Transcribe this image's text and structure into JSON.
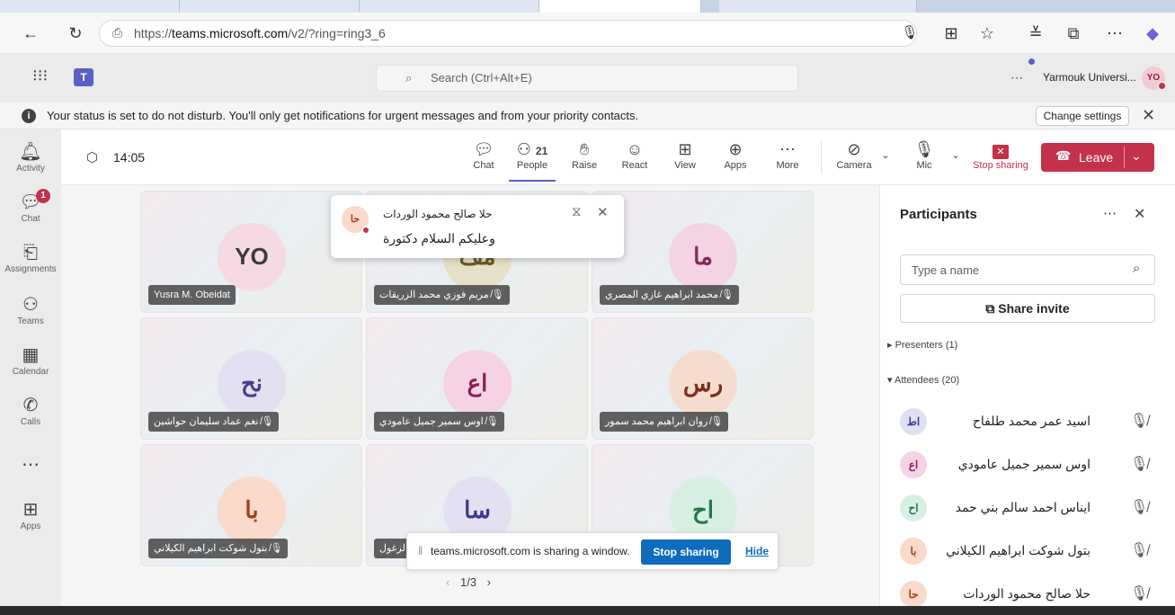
{
  "browser": {
    "url_prefix": "https://",
    "url_host": "teams.microsoft.com",
    "url_path": "/v2/?ring=ring3_6"
  },
  "header": {
    "search_placeholder": "Search (Ctrl+Alt+E)",
    "org_name": "Yarmouk Universi...",
    "user_initials": "YO"
  },
  "notification": {
    "text": "Your status is set to do not disturb. You'll only get notifications for urgent messages and from your priority contacts.",
    "button": "Change settings"
  },
  "rail": [
    {
      "label": "Activity"
    },
    {
      "label": "Chat",
      "badge": "1"
    },
    {
      "label": "Assignments"
    },
    {
      "label": "Teams"
    },
    {
      "label": "Calendar"
    },
    {
      "label": "Calls"
    },
    {
      "label": "Apps"
    }
  ],
  "meeting": {
    "timer": "14:05",
    "people_count": "21",
    "toolbar": {
      "chat": "Chat",
      "people": "People",
      "raise": "Raise",
      "react": "React",
      "view": "View",
      "apps": "Apps",
      "more": "More",
      "camera": "Camera",
      "mic": "Mic",
      "stop_sharing": "Stop sharing",
      "leave": "Leave"
    },
    "tiles": [
      {
        "initials": "YO",
        "name": "Yusra M. Obeidat",
        "color": "#f6d9e2",
        "text_color": "#3b3b3b"
      },
      {
        "initials": "مف",
        "name": "مريم فوزي محمد الزريقات",
        "color": "#e7e0c8",
        "text_color": "#6b5a2b"
      },
      {
        "initials": "ما",
        "name": "محمد ابراهيم غازي المصري",
        "color": "#f3d3e4",
        "text_color": "#7b2d5e"
      },
      {
        "initials": "نح",
        "name": "نغم عماد سليمان حواشين",
        "color": "#e4e0f2",
        "text_color": "#4a3e8c"
      },
      {
        "initials": "اع",
        "name": "اوس سمير جميل عامودي",
        "color": "#f6d3e4",
        "text_color": "#8a1f5a"
      },
      {
        "initials": "رس",
        "name": "روان ابراهيم محمد سمور",
        "color": "#f6dccf",
        "text_color": "#7a2f1a"
      },
      {
        "initials": "با",
        "name": "بتول شوكت ابراهيم الكيلاني",
        "color": "#fbd9cb",
        "text_color": "#a0401a"
      },
      {
        "initials": "سا",
        "name": "الزغول",
        "color": "#e4e0f2",
        "text_color": "#3f3a8a"
      },
      {
        "initials": "اح",
        "name": "",
        "color": "#d8f0e4",
        "text_color": "#1f7a4a"
      }
    ],
    "toast": {
      "sender": "حلا صالح محمود الوردات",
      "message": "وعليكم السلام دكتورة",
      "initials": "حا"
    },
    "share_bar": {
      "text": "teams.microsoft.com is sharing a window.",
      "stop": "Stop sharing",
      "hide": "Hide"
    },
    "pager": "1/3"
  },
  "panel": {
    "title": "Participants",
    "search_placeholder": "Type a name",
    "share_invite": "Share invite",
    "presenters": "Presenters (1)",
    "attendees": "Attendees (20)",
    "people": [
      {
        "name": "اسيد عمر محمد طلفاح",
        "initials": "اط",
        "color": "#e0e0f4",
        "text_color": "#3f3a8a"
      },
      {
        "name": "اوس سمير جميل عامودي",
        "initials": "اع",
        "color": "#f6d3e4",
        "text_color": "#8a1f5a"
      },
      {
        "name": "ايناس احمد سالم بني حمد",
        "initials": "اح",
        "color": "#d8f0e4",
        "text_color": "#1f7a4a"
      },
      {
        "name": "بتول شوكت ابراهيم الكيلاني",
        "initials": "با",
        "color": "#fbd9cb",
        "text_color": "#a0401a"
      },
      {
        "name": "حلا صالح محمود الوردات",
        "initials": "حا",
        "color": "#fbd9cb",
        "text_color": "#a0401a"
      }
    ]
  }
}
